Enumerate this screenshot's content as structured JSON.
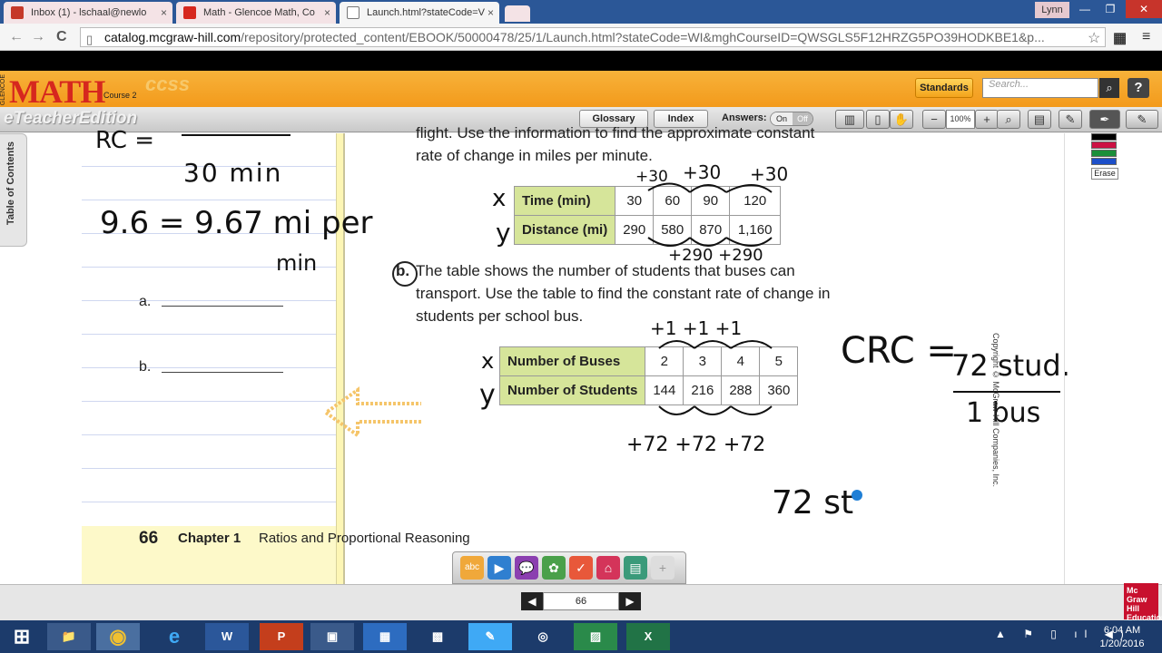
{
  "browser": {
    "tabs": [
      {
        "label": "Inbox (1) - lschaal@newlo",
        "fav_color": "#c53929"
      },
      {
        "label": "Math - Glencoe Math, Co",
        "fav_color": "#d6271e"
      },
      {
        "label": "Launch.html?stateCode=V",
        "fav_color": "#777777"
      }
    ],
    "tab_close": "×",
    "user": "Lynn",
    "url_host": "catalog.mcgraw-hill.com",
    "url_rest": "/repository/protected_content/EBOOK/50000478/25/1/Launch.html?stateCode=WI&mghCourseID=QWSGLS5F12HRZG5PO39HODKBE1&p...",
    "back_icon": "←",
    "forward_icon": "→",
    "reload_icon": "C",
    "star_icon": "☆",
    "menu_icon": "≡"
  },
  "app": {
    "math_logo": "MATH",
    "course_label": "Course 2",
    "ccss_label": "ccss",
    "glencoe_label": "GLENCOE",
    "edition_label": "eTeacherEdition",
    "standards_label": "Standards",
    "search_placeholder": "Search...",
    "help_label": "?",
    "search_icon": "🔍"
  },
  "toolbar": {
    "glossary": "Glossary",
    "index": "Index",
    "answers_label": "Answers:",
    "answers_on": "On",
    "answers_off": "Off",
    "zoom": "100%",
    "zoom_minus": "−",
    "zoom_plus": "+"
  },
  "sidebar": {
    "toc_label": "Table of Contents"
  },
  "notebook": {
    "blank_a": "a.",
    "blank_b": "b."
  },
  "problem_a": {
    "text_line1": "flight. Use the information to find the approximate constant",
    "text_line2": "rate of change in miles per minute.",
    "row1_header": "Time (min)",
    "row1_values": [
      "30",
      "60",
      "90",
      "120"
    ],
    "row2_header": "Distance (mi)",
    "row2_values": [
      "290",
      "580",
      "870",
      "1,160"
    ]
  },
  "problem_b": {
    "label": "b.",
    "text_line1": "The table shows the number of students that buses can",
    "text_line2": "transport. Use the table to find the constant rate of change in",
    "text_line3": "students per school bus.",
    "row1_header": "Number of Buses",
    "row1_values": [
      "2",
      "3",
      "4",
      "5"
    ],
    "row2_header": "Number of Students",
    "row2_values": [
      "144",
      "216",
      "288",
      "360"
    ]
  },
  "handwriting": {
    "rc_top": "RC = ",
    "thirty_min": "30 min",
    "nine_six": "9.6 = 9.67 mi per",
    "min": "min",
    "plus30_a": "+30",
    "plus30_b": "+30",
    "plus30_c": "+30",
    "plus290": "+290 +290",
    "x_a": "x",
    "y_a": "y",
    "x_b": "x",
    "y_b": "y",
    "plus1": "+1 +1 +1",
    "plus72": "+72 +72 +72",
    "crc": "CRC =",
    "crc_num": "72 stud.",
    "crc_den": "1 bus",
    "ans": "72 st"
  },
  "footer": {
    "copyright": "Copyright © McGraw-Hill Companies, Inc.",
    "page_number": "66",
    "chapter_label": "Chapter 1",
    "chapter_title": "Ratios and Proportional Reasoning"
  },
  "palette": {
    "colors": [
      "#000000",
      "#cc1144",
      "#1b8f3a",
      "#1d4fc9"
    ],
    "erase_label": "Erase"
  },
  "tray": {
    "icons": [
      "abc",
      "▶",
      "💬",
      "✿",
      "✓",
      "⌂",
      "▤",
      "+"
    ]
  },
  "pagenav": {
    "prev": "◀",
    "current": "66",
    "next": "▶"
  },
  "mgh_logo": "Mc Graw Hill Education",
  "taskbar": {
    "start_icon": "⊞",
    "apps": [
      "📁",
      "◉",
      "e",
      "W",
      "P",
      "▣",
      "▦",
      "▩",
      "✎",
      "◎",
      "▨",
      "X"
    ],
    "tray_icons": "▲ ⚑ ▯ ıl ◀)",
    "time": "6:04 AM",
    "date": "1/20/2016"
  }
}
